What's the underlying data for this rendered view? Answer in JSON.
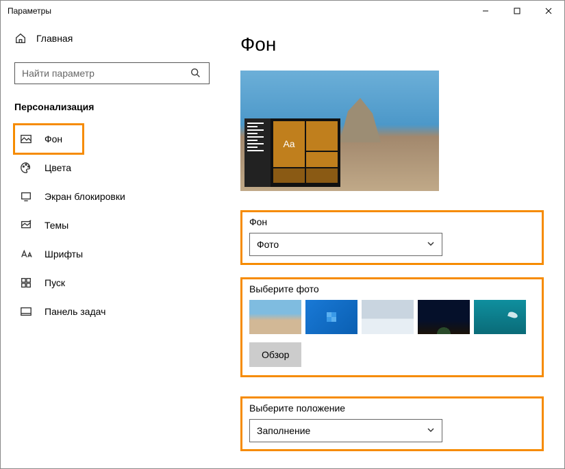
{
  "window": {
    "title": "Параметры"
  },
  "sidebar": {
    "home_label": "Главная",
    "search_placeholder": "Найти параметр",
    "section": "Персонализация",
    "items": [
      {
        "label": "Фон"
      },
      {
        "label": "Цвета"
      },
      {
        "label": "Экран блокировки"
      },
      {
        "label": "Темы"
      },
      {
        "label": "Шрифты"
      },
      {
        "label": "Пуск"
      },
      {
        "label": "Панель задач"
      }
    ]
  },
  "main": {
    "heading": "Фон",
    "preview_tile_text": "Aa",
    "background_section": {
      "label": "Фон",
      "selected": "Фото"
    },
    "photo_section": {
      "label": "Выберите фото",
      "browse_label": "Обзор"
    },
    "position_section": {
      "label": "Выберите положение",
      "selected": "Заполнение"
    }
  }
}
